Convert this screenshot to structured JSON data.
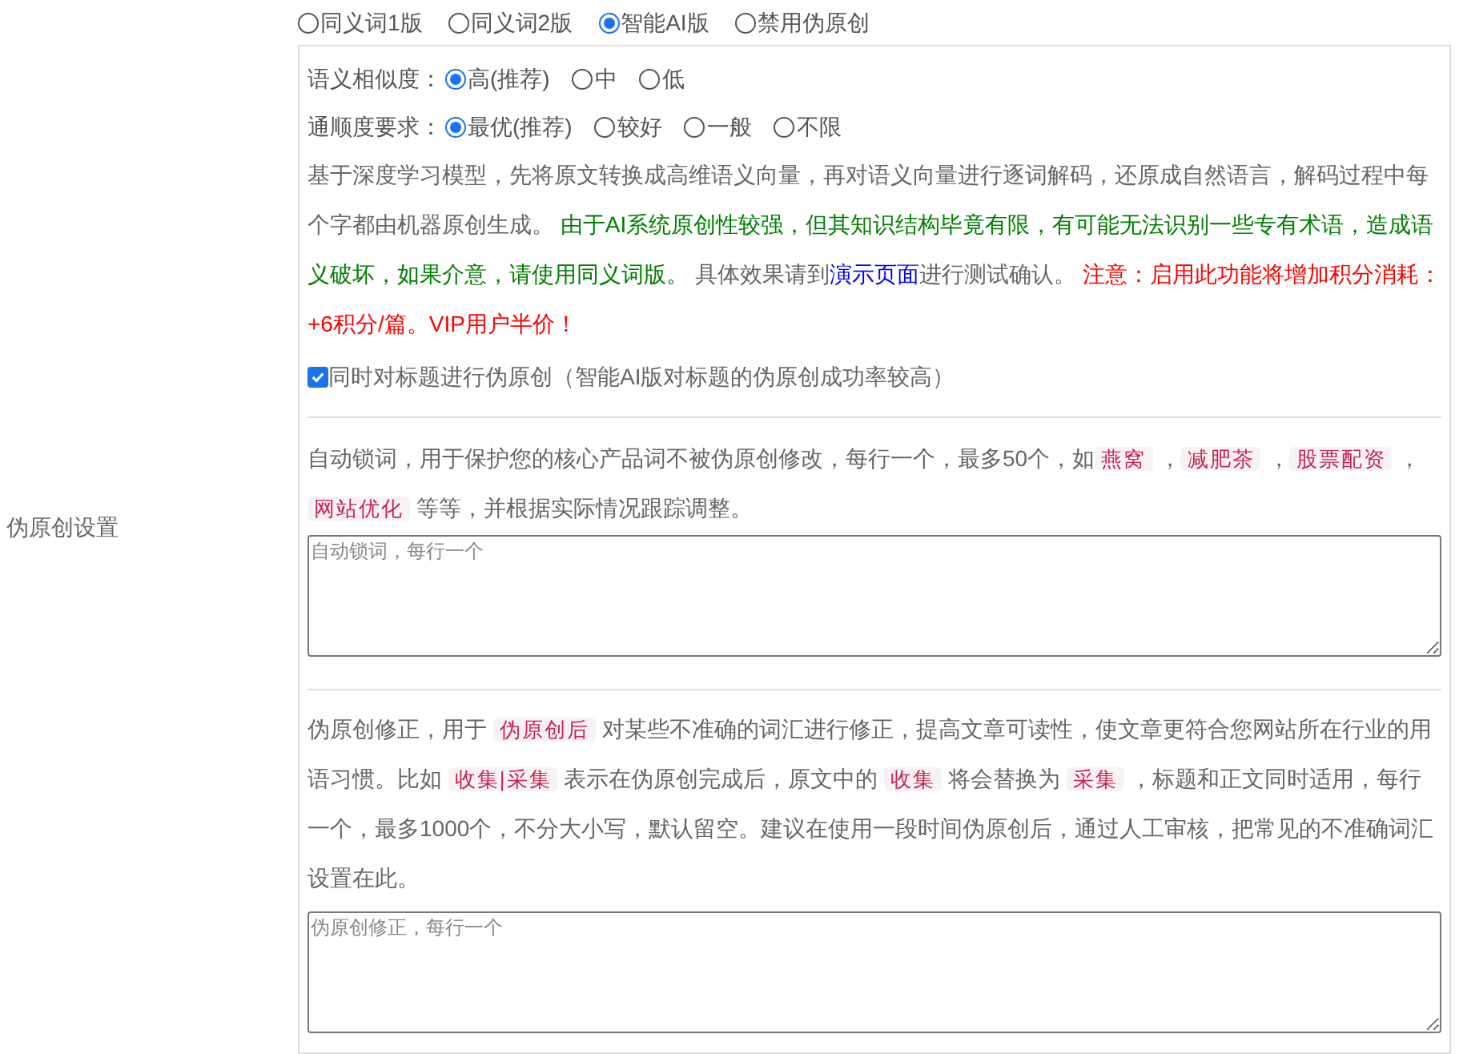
{
  "section_label": "伪原创设置",
  "mode_options": [
    {
      "label": "同义词1版",
      "selected": false
    },
    {
      "label": "同义词2版",
      "selected": false
    },
    {
      "label": "智能AI版",
      "selected": true
    },
    {
      "label": "禁用伪原创",
      "selected": false
    }
  ],
  "similarity": {
    "label": "语义相似度：",
    "options": [
      {
        "label": "高(推荐)",
        "selected": true
      },
      {
        "label": "中",
        "selected": false
      },
      {
        "label": "低",
        "selected": false
      }
    ]
  },
  "fluency": {
    "label": "通顺度要求：",
    "options": [
      {
        "label": "最优(推荐)",
        "selected": true
      },
      {
        "label": "较好",
        "selected": false
      },
      {
        "label": "一般",
        "selected": false
      },
      {
        "label": "不限",
        "selected": false
      }
    ]
  },
  "ai_description": [
    {
      "kind": "plain",
      "text": "基于深度学习模型，先将原文转换成高维语义向量，再对语义向量进行逐词解码，还原成自然语言，解码过程中每个字都由机器原创生成。 "
    },
    {
      "kind": "green",
      "text": "由于AI系统原创性较强，但其知识结构毕竟有限，有可能无法识别一些专有术语，造成语义破坏，如果介意，请使用同义词版。"
    },
    {
      "kind": "plain",
      "text": " 具体效果请到"
    },
    {
      "kind": "link",
      "text": "演示页面"
    },
    {
      "kind": "plain",
      "text": "进行测试确认。 "
    },
    {
      "kind": "red",
      "text": "注意：启用此功能将增加积分消耗：+6积分/篇。VIP用户半价！"
    }
  ],
  "title_option": {
    "label": "同时对标题进行伪原创（智能AI版对标题的伪原创成功率较高）",
    "checked": true
  },
  "lock_words": {
    "description": [
      {
        "kind": "plain",
        "text": "自动锁词，用于保护您的核心产品词不被伪原创修改，每行一个，最多50个，如"
      },
      {
        "kind": "code",
        "text": "燕窝"
      },
      {
        "kind": "plain",
        "text": " ，"
      },
      {
        "kind": "code",
        "text": "减肥茶"
      },
      {
        "kind": "plain",
        "text": " ，"
      },
      {
        "kind": "code",
        "text": "股票配资"
      },
      {
        "kind": "plain",
        "text": " ，"
      },
      {
        "kind": "code",
        "text": "网站优化"
      },
      {
        "kind": "plain",
        "text": " 等等，并根据实际情况跟踪调整。"
      }
    ],
    "placeholder": "自动锁词，每行一个"
  },
  "correction": {
    "description": [
      {
        "kind": "plain",
        "text": "伪原创修正，用于 "
      },
      {
        "kind": "code",
        "text": "伪原创后"
      },
      {
        "kind": "plain",
        "text": " 对某些不准确的词汇进行修正，提高文章可读性，使文章更符合您网站所在行业的用语习惯。比如 "
      },
      {
        "kind": "code",
        "text": "收集|采集"
      },
      {
        "kind": "plain",
        "text": " 表示在伪原创完成后，原文中的 "
      },
      {
        "kind": "code",
        "text": "收集"
      },
      {
        "kind": "plain",
        "text": " 将会替换为 "
      },
      {
        "kind": "code",
        "text": "采集"
      },
      {
        "kind": "plain",
        "text": " ，标题和正文同时适用，每行一个，最多1000个，不分大小写，默认留空。建议在使用一段时间伪原创后，通过人工审核，把常见的不准确词汇设置在此。"
      }
    ],
    "placeholder": "伪原创修正，每行一个"
  }
}
